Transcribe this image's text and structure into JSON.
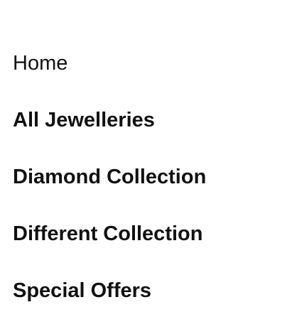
{
  "nav": {
    "items": [
      {
        "label": "Home"
      },
      {
        "label": "All Jewelleries"
      },
      {
        "label": "Diamond Collection"
      },
      {
        "label": "Different Collection"
      },
      {
        "label": "Special Offers"
      }
    ]
  }
}
